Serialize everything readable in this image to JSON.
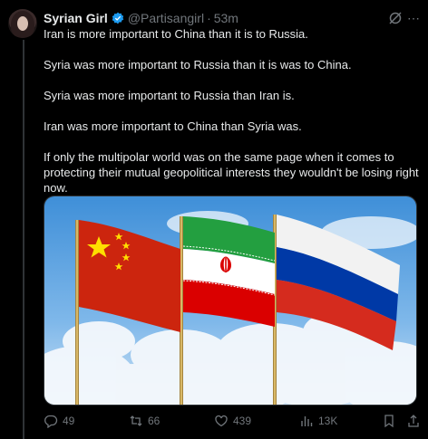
{
  "author": {
    "name": "Syrian Girl",
    "handle": "@Partisangirl",
    "separator": "·",
    "time": "53m"
  },
  "tweet": {
    "paragraphs": [
      "Iran is more important to China than it is to Russia.",
      "Syria was more important to Russia than it is was to China.",
      "Syria was more important to Russia than Iran is.",
      "Iran was more important to China than Syria was.",
      "If only the multipolar world was on the same page when it comes to protecting their mutual geopolitical interests they wouldn't be losing right now."
    ]
  },
  "media": {
    "flags": [
      "china-flag",
      "iran-flag",
      "russia-flag"
    ]
  },
  "actions": {
    "replies": "49",
    "reposts": "66",
    "likes": "439",
    "views": "13K"
  },
  "colors": {
    "background": "#000000",
    "text": "#e7e9ea",
    "muted": "#71767b",
    "verified": "#1d9bf0"
  }
}
